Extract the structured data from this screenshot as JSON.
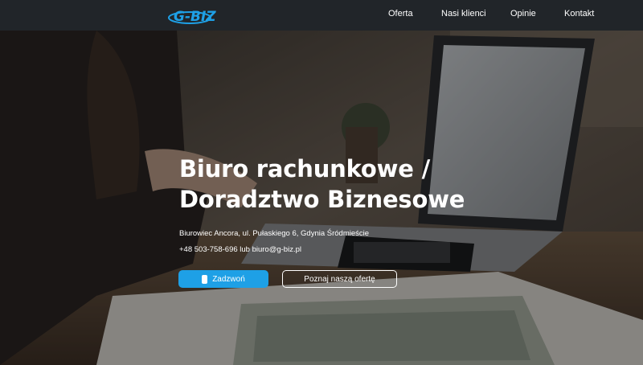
{
  "colors": {
    "navbar": "#212529",
    "accent": "#1ea0e6",
    "text": "#ffffff"
  },
  "brand": {
    "logo_text": "G-BIZ",
    "logo_icon": "gbiz-logo-icon"
  },
  "nav": {
    "items": [
      {
        "label": "Oferta"
      },
      {
        "label": "Nasi klienci"
      },
      {
        "label": "Opinie"
      },
      {
        "label": "Kontakt"
      }
    ]
  },
  "hero": {
    "title_line1": "Biuro rachunkowe /",
    "title_line2": "Doradztwo Biznesowe",
    "address": "Biurowiec Ancora, ul. Pułaskiego 6, Gdynia Śródmieście",
    "contact": "+48 503-758-696 lub biuro@g-biz.pl",
    "call_button": "Zadzwoń",
    "call_icon": "smartphone-icon",
    "offer_button": "Poznaj naszą ofertę"
  }
}
